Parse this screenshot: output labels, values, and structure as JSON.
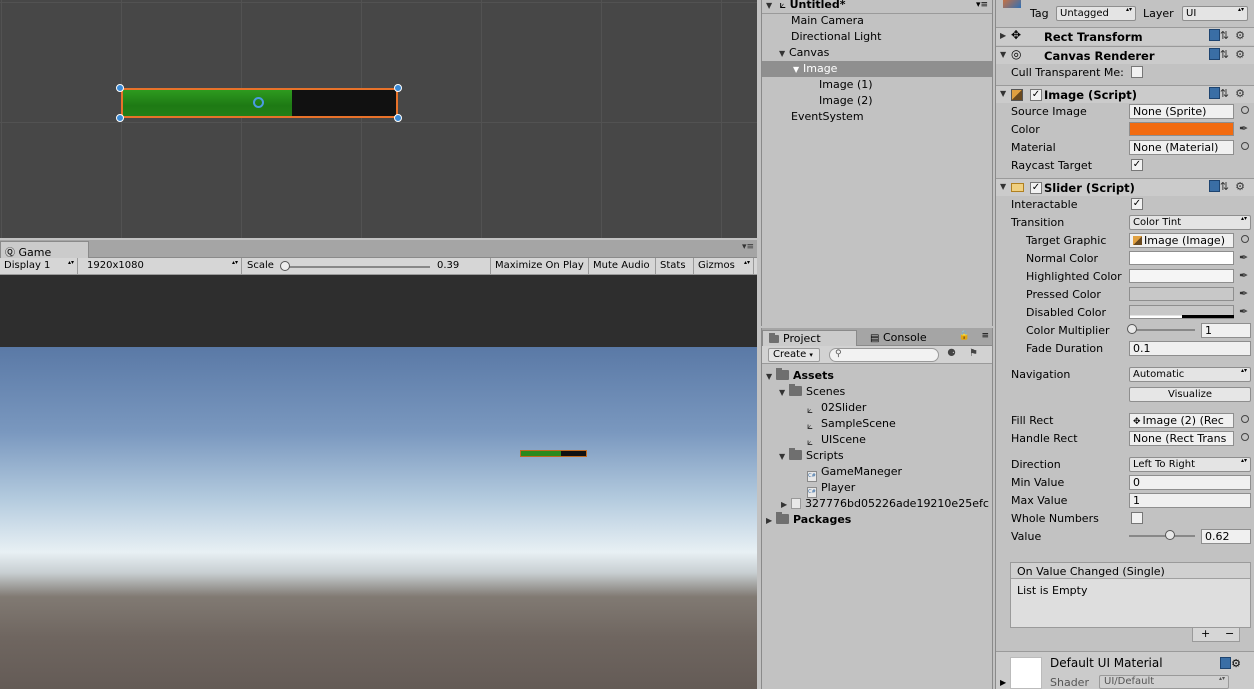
{
  "game": {
    "tab_label": "Game",
    "display": "Display 1",
    "resolution": "1920x1080",
    "scale_label": "Scale",
    "scale_value": "0.39",
    "maximize": "Maximize On Play",
    "mute": "Mute Audio",
    "stats": "Stats",
    "gizmos": "Gizmos"
  },
  "slider_fill_fraction": 0.62,
  "hierarchy": {
    "scene_name": "Untitled*",
    "items": [
      {
        "label": "Main Camera"
      },
      {
        "label": "Directional Light"
      },
      {
        "label": "Canvas"
      },
      {
        "label": "Image"
      },
      {
        "label": "Image (1)"
      },
      {
        "label": "Image (2)"
      },
      {
        "label": "EventSystem"
      }
    ]
  },
  "project": {
    "tab_project": "Project",
    "tab_console": "Console",
    "create": "Create",
    "items": [
      {
        "label": "Assets"
      },
      {
        "label": "Scenes"
      },
      {
        "label": "02Slider"
      },
      {
        "label": "SampleScene"
      },
      {
        "label": "UIScene"
      },
      {
        "label": "Scripts"
      },
      {
        "label": "GameManeger"
      },
      {
        "label": "Player"
      },
      {
        "label": "327776bd05226ade19210e25efc"
      },
      {
        "label": "Packages"
      }
    ]
  },
  "inspector": {
    "tag_label": "Tag",
    "tag_value": "Untagged",
    "layer_label": "Layer",
    "layer_value": "UI",
    "rect_transform": "Rect Transform",
    "canvas_renderer": "Canvas Renderer",
    "cull_label": "Cull Transparent Me:",
    "image_title": "Image (Script)",
    "source_image_label": "Source Image",
    "source_image_value": "None (Sprite)",
    "color_label": "Color",
    "color_value": "#f26b10",
    "material_label": "Material",
    "material_value": "None (Material)",
    "raycast_label": "Raycast Target",
    "slider_title": "Slider (Script)",
    "interactable_label": "Interactable",
    "transition_label": "Transition",
    "transition_value": "Color Tint",
    "target_graphic_label": "Target Graphic",
    "target_graphic_value": "Image (Image)",
    "normal_color_label": "Normal Color",
    "highlighted_color_label": "Highlighted Color",
    "pressed_color_label": "Pressed Color",
    "disabled_color_label": "Disabled Color",
    "color_multiplier_label": "Color Multiplier",
    "color_multiplier_value": "1",
    "fade_duration_label": "Fade Duration",
    "fade_duration_value": "0.1",
    "navigation_label": "Navigation",
    "navigation_value": "Automatic",
    "visualize": "Visualize",
    "fill_rect_label": "Fill Rect",
    "fill_rect_value": "Image (2) (Rec",
    "handle_rect_label": "Handle Rect",
    "handle_rect_value": "None (Rect Trans",
    "direction_label": "Direction",
    "direction_value": "Left To Right",
    "min_value_label": "Min Value",
    "min_value": "0",
    "max_value_label": "Max Value",
    "max_value": "1",
    "whole_numbers_label": "Whole Numbers",
    "value_label": "Value",
    "value": "0.62",
    "on_value_changed": "On Value Changed (Single)",
    "list_empty": "List is Empty",
    "material_name": "Default UI Material",
    "shader_label": "Shader",
    "shader_value": "UI/Default"
  }
}
